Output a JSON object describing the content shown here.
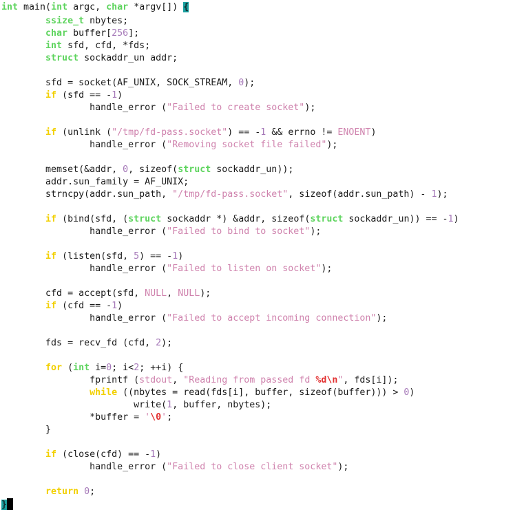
{
  "editor": {
    "name": "code-editor",
    "language": "C",
    "background": "#ffffff",
    "colors": {
      "keyword": "#f2d000",
      "type": "#5ed45e",
      "number": "#a578b8",
      "string": "#cf82ad",
      "constant": "#cf82ad",
      "escape": "#e23030",
      "plain": "#1a1a1a",
      "brace_match_bg": "#1aa0a0",
      "cursor": "#000000"
    },
    "cursor_line": 41,
    "cursor_column": 2
  },
  "lines": [
    {
      "n": 1,
      "tokens": [
        {
          "t": "type",
          "v": "int"
        },
        {
          "t": "plain",
          "v": " main("
        },
        {
          "t": "type",
          "v": "int"
        },
        {
          "t": "plain",
          "v": " argc, "
        },
        {
          "t": "type",
          "v": "char"
        },
        {
          "t": "plain",
          "v": " *argv[]) "
        },
        {
          "t": "brace",
          "v": "{"
        }
      ]
    },
    {
      "n": 2,
      "tokens": [
        {
          "t": "type",
          "v": "        ssize_t"
        },
        {
          "t": "plain",
          "v": " nbytes;"
        }
      ]
    },
    {
      "n": 3,
      "tokens": [
        {
          "t": "type",
          "v": "        char"
        },
        {
          "t": "plain",
          "v": " buffer["
        },
        {
          "t": "num",
          "v": "256"
        },
        {
          "t": "plain",
          "v": "];"
        }
      ]
    },
    {
      "n": 4,
      "tokens": [
        {
          "t": "type",
          "v": "        int"
        },
        {
          "t": "plain",
          "v": " sfd, cfd, *fds;"
        }
      ]
    },
    {
      "n": 5,
      "tokens": [
        {
          "t": "type",
          "v": "        struct"
        },
        {
          "t": "plain",
          "v": " sockaddr_un addr;"
        }
      ]
    },
    {
      "n": 6,
      "tokens": []
    },
    {
      "n": 7,
      "tokens": [
        {
          "t": "plain",
          "v": "        sfd = socket(AF_UNIX, SOCK_STREAM, "
        },
        {
          "t": "num",
          "v": "0"
        },
        {
          "t": "plain",
          "v": ");"
        }
      ]
    },
    {
      "n": 8,
      "tokens": [
        {
          "t": "kw",
          "v": "        if"
        },
        {
          "t": "plain",
          "v": " (sfd == -"
        },
        {
          "t": "num",
          "v": "1"
        },
        {
          "t": "plain",
          "v": ")"
        }
      ]
    },
    {
      "n": 9,
      "tokens": [
        {
          "t": "plain",
          "v": "                handle_error ("
        },
        {
          "t": "str",
          "v": "\"Failed to create socket\""
        },
        {
          "t": "plain",
          "v": ");"
        }
      ]
    },
    {
      "n": 10,
      "tokens": []
    },
    {
      "n": 11,
      "tokens": [
        {
          "t": "kw",
          "v": "        if"
        },
        {
          "t": "plain",
          "v": " (unlink ("
        },
        {
          "t": "str",
          "v": "\"/tmp/fd-pass.socket\""
        },
        {
          "t": "plain",
          "v": ") == -"
        },
        {
          "t": "num",
          "v": "1"
        },
        {
          "t": "plain",
          "v": " && errno != "
        },
        {
          "t": "const",
          "v": "ENOENT"
        },
        {
          "t": "plain",
          "v": ")"
        }
      ]
    },
    {
      "n": 12,
      "tokens": [
        {
          "t": "plain",
          "v": "                handle_error ("
        },
        {
          "t": "str",
          "v": "\"Removing socket file failed\""
        },
        {
          "t": "plain",
          "v": ");"
        }
      ]
    },
    {
      "n": 13,
      "tokens": []
    },
    {
      "n": 14,
      "tokens": [
        {
          "t": "plain",
          "v": "        memset(&addr, "
        },
        {
          "t": "num",
          "v": "0"
        },
        {
          "t": "plain",
          "v": ", sizeof("
        },
        {
          "t": "type",
          "v": "struct"
        },
        {
          "t": "plain",
          "v": " sockaddr_un));"
        }
      ]
    },
    {
      "n": 15,
      "tokens": [
        {
          "t": "plain",
          "v": "        addr.sun_family = AF_UNIX;"
        }
      ]
    },
    {
      "n": 16,
      "tokens": [
        {
          "t": "plain",
          "v": "        strncpy(addr.sun_path, "
        },
        {
          "t": "str",
          "v": "\"/tmp/fd-pass.socket\""
        },
        {
          "t": "plain",
          "v": ", sizeof(addr.sun_path) - "
        },
        {
          "t": "num",
          "v": "1"
        },
        {
          "t": "plain",
          "v": ");"
        }
      ]
    },
    {
      "n": 17,
      "tokens": []
    },
    {
      "n": 18,
      "tokens": [
        {
          "t": "kw",
          "v": "        if"
        },
        {
          "t": "plain",
          "v": " (bind(sfd, ("
        },
        {
          "t": "type",
          "v": "struct"
        },
        {
          "t": "plain",
          "v": " sockaddr *) &addr, sizeof("
        },
        {
          "t": "type",
          "v": "struct"
        },
        {
          "t": "plain",
          "v": " sockaddr_un)) == -"
        },
        {
          "t": "num",
          "v": "1"
        },
        {
          "t": "plain",
          "v": ")"
        }
      ]
    },
    {
      "n": 19,
      "tokens": [
        {
          "t": "plain",
          "v": "                handle_error ("
        },
        {
          "t": "str",
          "v": "\"Failed to bind to socket\""
        },
        {
          "t": "plain",
          "v": ");"
        }
      ]
    },
    {
      "n": 20,
      "tokens": []
    },
    {
      "n": 21,
      "tokens": [
        {
          "t": "kw",
          "v": "        if"
        },
        {
          "t": "plain",
          "v": " (listen(sfd, "
        },
        {
          "t": "num",
          "v": "5"
        },
        {
          "t": "plain",
          "v": ") == -"
        },
        {
          "t": "num",
          "v": "1"
        },
        {
          "t": "plain",
          "v": ")"
        }
      ]
    },
    {
      "n": 22,
      "tokens": [
        {
          "t": "plain",
          "v": "                handle_error ("
        },
        {
          "t": "str",
          "v": "\"Failed to listen on socket\""
        },
        {
          "t": "plain",
          "v": ");"
        }
      ]
    },
    {
      "n": 23,
      "tokens": []
    },
    {
      "n": 24,
      "tokens": [
        {
          "t": "plain",
          "v": "        cfd = accept(sfd, "
        },
        {
          "t": "const",
          "v": "NULL"
        },
        {
          "t": "plain",
          "v": ", "
        },
        {
          "t": "const",
          "v": "NULL"
        },
        {
          "t": "plain",
          "v": ");"
        }
      ]
    },
    {
      "n": 25,
      "tokens": [
        {
          "t": "kw",
          "v": "        if"
        },
        {
          "t": "plain",
          "v": " (cfd == -"
        },
        {
          "t": "num",
          "v": "1"
        },
        {
          "t": "plain",
          "v": ")"
        }
      ]
    },
    {
      "n": 26,
      "tokens": [
        {
          "t": "plain",
          "v": "                handle_error ("
        },
        {
          "t": "str",
          "v": "\"Failed to accept incoming connection\""
        },
        {
          "t": "plain",
          "v": ");"
        }
      ]
    },
    {
      "n": 27,
      "tokens": []
    },
    {
      "n": 28,
      "tokens": [
        {
          "t": "plain",
          "v": "        fds = recv_fd (cfd, "
        },
        {
          "t": "num",
          "v": "2"
        },
        {
          "t": "plain",
          "v": ");"
        }
      ]
    },
    {
      "n": 29,
      "tokens": []
    },
    {
      "n": 30,
      "tokens": [
        {
          "t": "kw",
          "v": "        for"
        },
        {
          "t": "plain",
          "v": " ("
        },
        {
          "t": "type",
          "v": "int"
        },
        {
          "t": "plain",
          "v": " i="
        },
        {
          "t": "num",
          "v": "0"
        },
        {
          "t": "plain",
          "v": "; i<"
        },
        {
          "t": "num",
          "v": "2"
        },
        {
          "t": "plain",
          "v": "; ++i) {"
        }
      ]
    },
    {
      "n": 31,
      "tokens": [
        {
          "t": "plain",
          "v": "                fprintf ("
        },
        {
          "t": "const",
          "v": "stdout"
        },
        {
          "t": "plain",
          "v": ", "
        },
        {
          "t": "str",
          "v": "\"Reading from passed fd "
        },
        {
          "t": "esc",
          "v": "%d\\n"
        },
        {
          "t": "str",
          "v": "\""
        },
        {
          "t": "plain",
          "v": ", fds[i]);"
        }
      ]
    },
    {
      "n": 32,
      "tokens": [
        {
          "t": "kw",
          "v": "                while"
        },
        {
          "t": "plain",
          "v": " ((nbytes = read(fds[i], buffer, sizeof(buffer))) > "
        },
        {
          "t": "num",
          "v": "0"
        },
        {
          "t": "plain",
          "v": ")"
        }
      ]
    },
    {
      "n": 33,
      "tokens": [
        {
          "t": "plain",
          "v": "                        write("
        },
        {
          "t": "num",
          "v": "1"
        },
        {
          "t": "plain",
          "v": ", buffer, nbytes);"
        }
      ]
    },
    {
      "n": 34,
      "tokens": [
        {
          "t": "plain",
          "v": "                *buffer = "
        },
        {
          "t": "str",
          "v": "'"
        },
        {
          "t": "esc",
          "v": "\\0"
        },
        {
          "t": "str",
          "v": "'"
        },
        {
          "t": "plain",
          "v": ";"
        }
      ]
    },
    {
      "n": 35,
      "tokens": [
        {
          "t": "plain",
          "v": "        }"
        }
      ]
    },
    {
      "n": 36,
      "tokens": []
    },
    {
      "n": 37,
      "tokens": [
        {
          "t": "kw",
          "v": "        if"
        },
        {
          "t": "plain",
          "v": " (close(cfd) == -"
        },
        {
          "t": "num",
          "v": "1"
        },
        {
          "t": "plain",
          "v": ")"
        }
      ]
    },
    {
      "n": 38,
      "tokens": [
        {
          "t": "plain",
          "v": "                handle_error ("
        },
        {
          "t": "str",
          "v": "\"Failed to close client socket\""
        },
        {
          "t": "plain",
          "v": ");"
        }
      ]
    },
    {
      "n": 39,
      "tokens": []
    },
    {
      "n": 40,
      "tokens": [
        {
          "t": "kw",
          "v": "        return"
        },
        {
          "t": "plain",
          "v": " "
        },
        {
          "t": "num",
          "v": "0"
        },
        {
          "t": "plain",
          "v": ";"
        }
      ]
    },
    {
      "n": 41,
      "tokens": [
        {
          "t": "brace",
          "v": "}"
        },
        {
          "t": "cursor",
          "v": " "
        }
      ]
    }
  ]
}
